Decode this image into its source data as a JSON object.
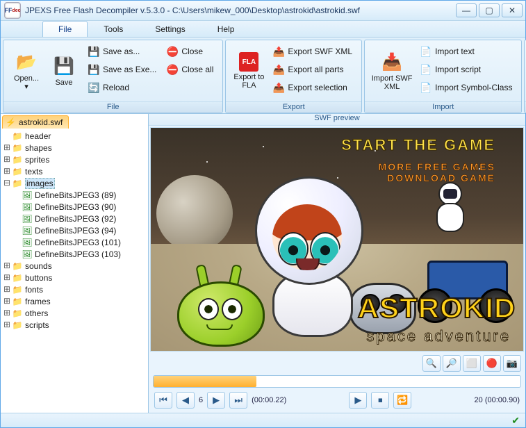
{
  "title": "JPEXS Free Flash Decompiler v.5.3.0 - C:\\Users\\mikew_000\\Desktop\\astrokid\\astrokid.swf",
  "menus": {
    "file": "File",
    "tools": "Tools",
    "settings": "Settings",
    "help": "Help"
  },
  "ribbon": {
    "file": {
      "label": "File",
      "open": "Open...",
      "save": "Save",
      "save_as": "Save as...",
      "save_as_exe": "Save as Exe...",
      "reload": "Reload",
      "close": "Close",
      "close_all": "Close all"
    },
    "export": {
      "label": "Export",
      "to_fla": "Export to FLA",
      "swf_xml": "Export SWF XML",
      "all_parts": "Export all parts",
      "selection": "Export selection"
    },
    "import": {
      "label": "Import",
      "swf_xml": "Import SWF XML",
      "text": "Import text",
      "script": "Import script",
      "symbol": "Import Symbol-Class"
    }
  },
  "tree": {
    "tab": "astrokid.swf",
    "nodes": [
      {
        "label": "header",
        "icon": "folder",
        "depth": 1,
        "expander": ""
      },
      {
        "label": "shapes",
        "icon": "folder",
        "depth": 1,
        "expander": "+"
      },
      {
        "label": "sprites",
        "icon": "folder",
        "depth": 1,
        "expander": "+"
      },
      {
        "label": "texts",
        "icon": "folder",
        "depth": 1,
        "expander": "+"
      },
      {
        "label": "images",
        "icon": "folder",
        "depth": 1,
        "expander": "-",
        "selected": true
      },
      {
        "label": "DefineBitsJPEG3 (89)",
        "icon": "image",
        "depth": 2,
        "expander": ""
      },
      {
        "label": "DefineBitsJPEG3 (90)",
        "icon": "image",
        "depth": 2,
        "expander": ""
      },
      {
        "label": "DefineBitsJPEG3 (92)",
        "icon": "image",
        "depth": 2,
        "expander": ""
      },
      {
        "label": "DefineBitsJPEG3 (94)",
        "icon": "image",
        "depth": 2,
        "expander": ""
      },
      {
        "label": "DefineBitsJPEG3 (101)",
        "icon": "image",
        "depth": 2,
        "expander": ""
      },
      {
        "label": "DefineBitsJPEG3 (103)",
        "icon": "image",
        "depth": 2,
        "expander": ""
      },
      {
        "label": "sounds",
        "icon": "folder",
        "depth": 1,
        "expander": "+"
      },
      {
        "label": "buttons",
        "icon": "folder",
        "depth": 1,
        "expander": "+"
      },
      {
        "label": "fonts",
        "icon": "folder",
        "depth": 1,
        "expander": "+"
      },
      {
        "label": "frames",
        "icon": "folder",
        "depth": 1,
        "expander": "+"
      },
      {
        "label": "others",
        "icon": "folder",
        "depth": 1,
        "expander": "+"
      },
      {
        "label": "scripts",
        "icon": "folder",
        "depth": 1,
        "expander": "+"
      }
    ]
  },
  "preview": {
    "title": "SWF preview",
    "menu1": "start the game",
    "menu2": "more free games",
    "menu3": "download game",
    "logo": "ASTROKID",
    "subtitle": "space adventure"
  },
  "playback": {
    "current_frame": "6",
    "current_time": "(00:00.22)",
    "total_frames": "20",
    "total_time": "(00:00.90)"
  }
}
